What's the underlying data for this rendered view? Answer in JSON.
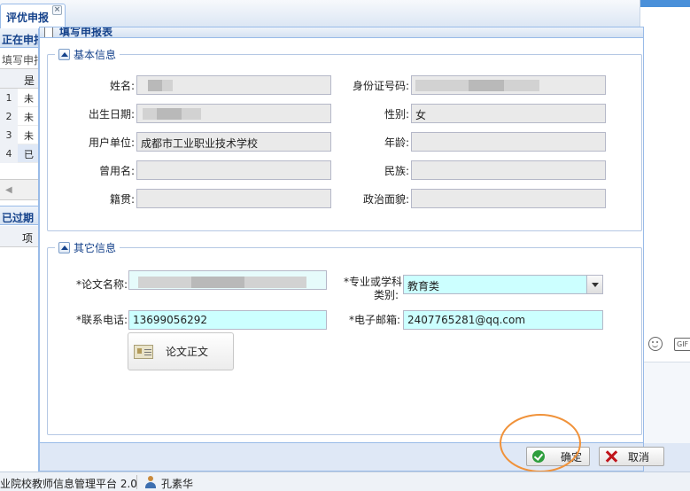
{
  "tab": {
    "label": "评优申报",
    "close": "×"
  },
  "left_panel": {
    "section1_title": "正在申报",
    "section1_sub": "填写申报",
    "col_header": "是",
    "rows": [
      {
        "n": "1",
        "v": "未"
      },
      {
        "n": "2",
        "v": "未"
      },
      {
        "n": "3",
        "v": "未"
      },
      {
        "n": "4",
        "v": "已"
      }
    ],
    "scroll_glyph": "◀",
    "section2_title": "已过期",
    "section2_col": "项"
  },
  "dialog": {
    "title": "填写申报表",
    "basic": {
      "legend": "基本信息",
      "name_label": "姓名:",
      "id_label": "身份证号码:",
      "birth_label": "出生日期:",
      "gender_label": "性别:",
      "gender_value": "女",
      "unit_label": "用户单位:",
      "unit_value": "成都市工业职业技术学校",
      "age_label": "年龄:",
      "former_name_label": "曾用名:",
      "ethnicity_label": "民族:",
      "native_label": "籍贯:",
      "political_label": "政治面貌:"
    },
    "other": {
      "legend": "其它信息",
      "paper_title_label": "*论文名称:",
      "major_label_1": "*专业或学科",
      "major_label_2": "类别:",
      "major_value": "教育类",
      "phone_label": "*联系电话:",
      "phone_value": "13699056292",
      "email_label": "*电子邮箱:",
      "email_value": "2407765281@qq.com",
      "paper_button": "论文正文"
    },
    "ok_button": "确定",
    "cancel_button": "取消"
  },
  "right_panel": {
    "gif_label": "GIF"
  },
  "statusbar": {
    "app_name": "业院校教师信息管理平台 2.0",
    "user_name": "孔素华"
  },
  "colors": {
    "accent": "#15428b",
    "required_field": "#ccffff",
    "highlight": "#f0923a"
  }
}
